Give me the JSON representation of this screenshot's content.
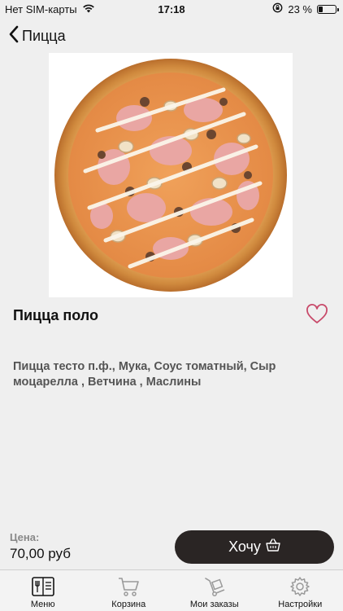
{
  "status_bar": {
    "carrier": "Нет SIM-карты",
    "time": "17:18",
    "battery": "23 %",
    "battery_level": 0.23
  },
  "nav": {
    "back_label": "Пицца"
  },
  "product": {
    "title": "Пицца поло",
    "description": "Пицца тесто п.ф., Мука, Соус томатный, Сыр моцарелла , Ветчина , Маслины",
    "price_label": "Цена:",
    "price_value": "70,00 руб"
  },
  "actions": {
    "want_label": "Хочу"
  },
  "tabs": [
    {
      "label": "Меню",
      "icon": "menu-book-icon"
    },
    {
      "label": "Корзина",
      "icon": "cart-icon"
    },
    {
      "label": "Мои заказы",
      "icon": "hand-truck-icon"
    },
    {
      "label": "Настройки",
      "icon": "gear-icon"
    }
  ],
  "colors": {
    "background": "#efefef",
    "button": "#2a2524",
    "heart": "#c84a6a"
  }
}
